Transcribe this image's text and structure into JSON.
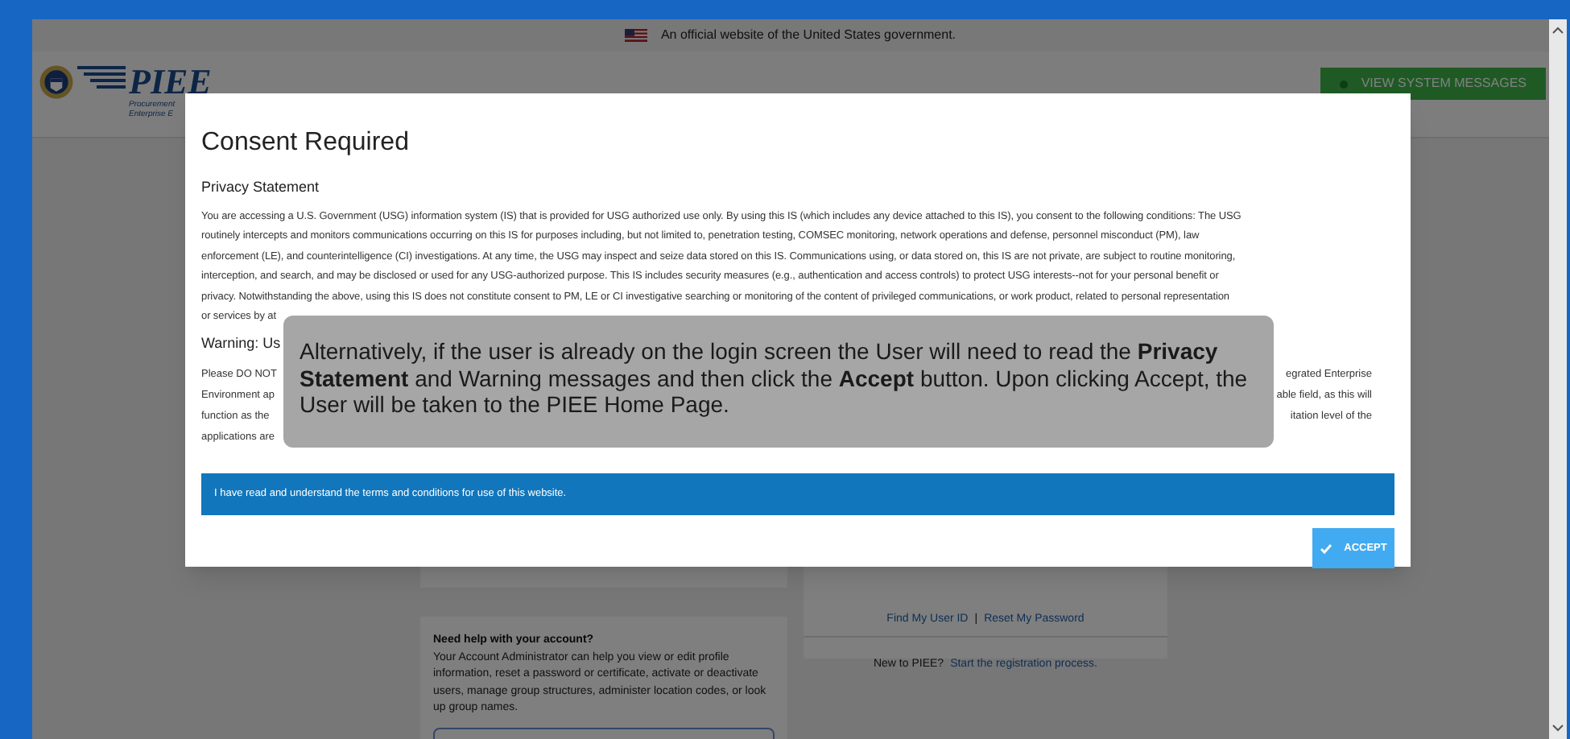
{
  "banner": {
    "text": "An official website of the United States government."
  },
  "header": {
    "logo_text": "PIEE",
    "logo_subtitle": [
      "Procurement",
      "Enterprise E"
    ],
    "button": "VIEW SYSTEM MESSAGES"
  },
  "page": {
    "login_links": [
      "Find My User ID",
      "Reset My Password"
    ],
    "separator": "|",
    "register_prompt": "New to PIEE?",
    "register_link": "Start the registration process.",
    "help": {
      "title": "Need help with your account?",
      "body": "Your Account Administrator can help you view or edit profile information, reset a password or certificate, activate or deactivate users, manage group structures, administer location codes, or look up group names."
    }
  },
  "modal": {
    "title": "Consent Required",
    "privacy": {
      "heading": "Privacy Statement",
      "lines": [
        "You are accessing a U.S. Government (USG) information system (IS) that is provided for USG authorized use only. By using this IS (which includes any device attached to this IS), you consent to the following conditions: The USG",
        "routinely intercepts and monitors communications occurring on this IS for purposes including, but not limited to, penetration testing, COMSEC monitoring, network operations and defense, personnel misconduct (PM), law",
        "enforcement (LE), and counterintelligence (CI) investigations. At any time, the USG may inspect and seize data stored on this IS. Communications using, or data stored on, this IS are not private, are subject to routine monitoring,",
        "interception, and search, and may be disclosed or used for any USG-authorized purpose. This IS includes security measures (e.g., authentication and access controls) to protect USG interests--not for your personal benefit or",
        "privacy. Notwithstanding the above, using this IS does not constitute consent to PM, LE or CI investigative searching or monitoring of the content of privileged communications, or work product, related to personal representation",
        "or services by at"
      ]
    },
    "warning": {
      "heading": "Warning: Us",
      "lines": [
        {
          "left": "Please DO NOT",
          "right": "egrated Enterprise"
        },
        {
          "left": "Environment ap",
          "right": "able field, as this will"
        },
        {
          "left": "function as the",
          "right": "itation level of the"
        },
        {
          "left": "applications are"
        }
      ]
    },
    "agreement": "I have read and understand the terms and conditions for use of this website.",
    "accept_button": "ACCEPT"
  },
  "callout": {
    "text": "Alternatively, if the user is already on the login screen the User will need to read the **Privacy Statement** and Warning messages and then click the **Accept** button. Upon clicking Accept, the User will be taken to the PIEE Home Page."
  }
}
